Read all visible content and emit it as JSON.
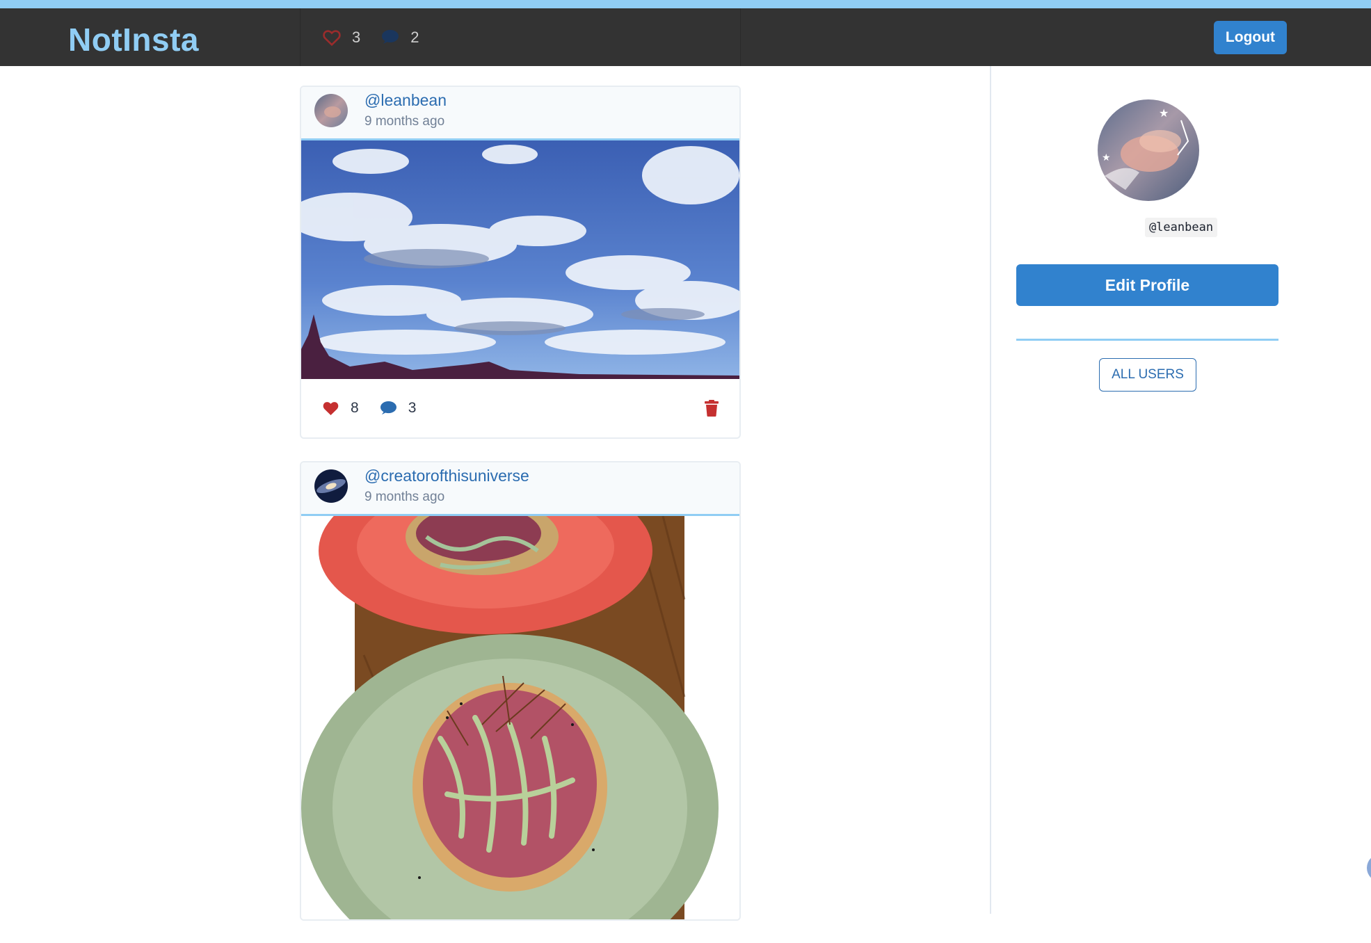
{
  "app": {
    "brand": "NotInsta"
  },
  "nav": {
    "likes_count": "3",
    "comments_count": "2",
    "logout_label": "Logout"
  },
  "posts": [
    {
      "username": "@leanbean",
      "time": "9 months ago",
      "likes": "8",
      "comments": "3",
      "photo": "sky-with-clouds"
    },
    {
      "username": "@creatorofthisuniverse",
      "time": "9 months ago",
      "photo": "tostadas-on-plates"
    }
  ],
  "sidebar": {
    "handle": "@leanbean",
    "edit_profile_label": "Edit Profile",
    "all_users_label": "ALL USERS"
  },
  "colors": {
    "accent": "#3182ce",
    "brand": "#90cdf4",
    "nav_bg": "#333333",
    "danger": "#c53030"
  },
  "icons": [
    "heart-icon",
    "comment-icon",
    "trash-icon"
  ]
}
